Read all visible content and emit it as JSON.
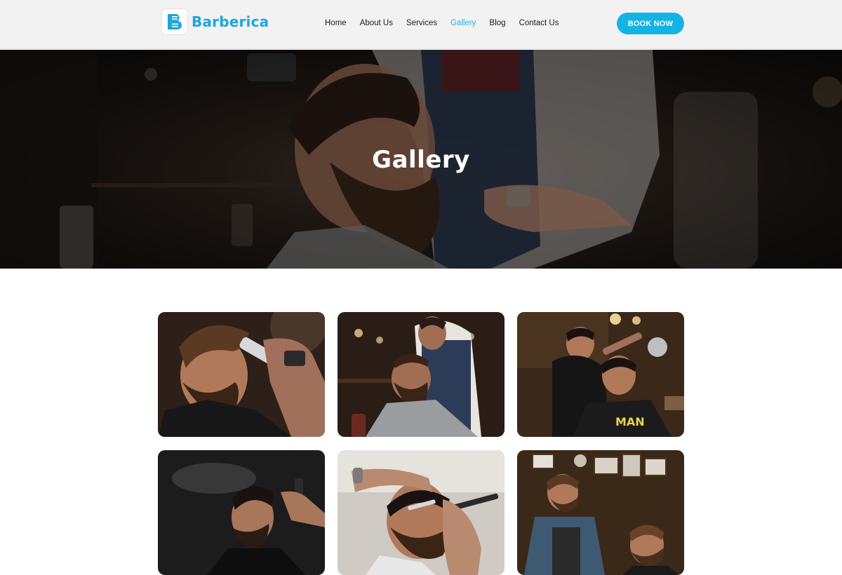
{
  "brand": {
    "name": "Barberica",
    "logo_letter": "B",
    "accent_color": "#1fa6dd"
  },
  "nav": {
    "items": [
      {
        "label": "Home",
        "active": false
      },
      {
        "label": "About Us",
        "active": false
      },
      {
        "label": "Services",
        "active": false
      },
      {
        "label": "Gallery",
        "active": true
      },
      {
        "label": "Blog",
        "active": false
      },
      {
        "label": "Contact Us",
        "active": false
      }
    ],
    "cta_label": "BOOK NOW",
    "cta_color": "#14b3e6"
  },
  "hero": {
    "title": "Gallery",
    "image": "bearded-man-barber-photo"
  },
  "gallery": {
    "images": [
      {
        "name": "clipper-fade-photo"
      },
      {
        "name": "beard-trim-photo"
      },
      {
        "name": "barbershop-haircut-photo"
      },
      {
        "name": "hair-spray-styling-photo"
      },
      {
        "name": "straight-razor-shave-photo"
      },
      {
        "name": "barber-beard-grooming-photo"
      }
    ],
    "sign_text": "MAN"
  }
}
